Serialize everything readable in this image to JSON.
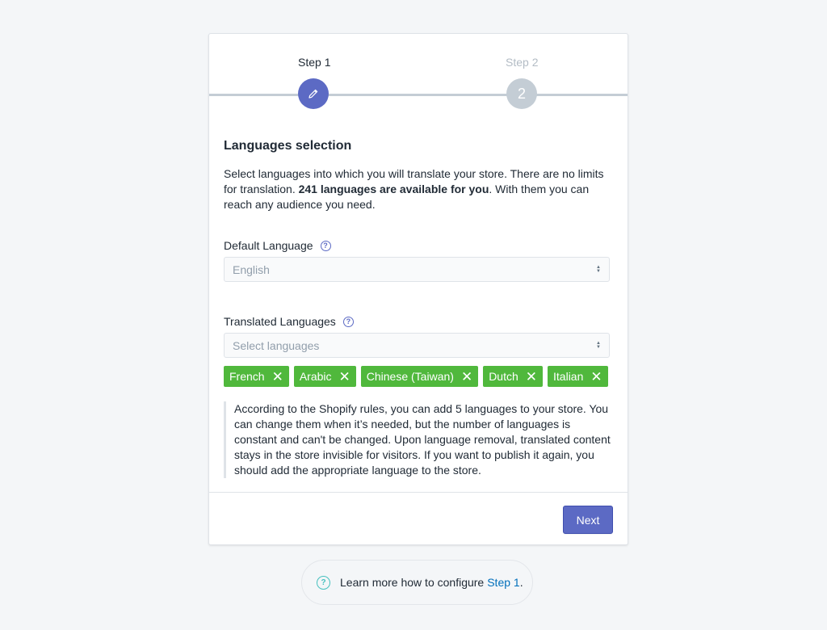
{
  "steps": {
    "step1_label": "Step 1",
    "step2_label": "Step 2",
    "step2_number": "2"
  },
  "section": {
    "title": "Languages selection",
    "desc_part1": "Select languages into which you will translate your store. There are no limits for translation. ",
    "desc_bold": "241 languages are available for you",
    "desc_part2": ". With them you can reach any audience you need."
  },
  "default_language": {
    "label": "Default Language",
    "value": "English"
  },
  "translated_languages": {
    "label": "Translated Languages",
    "placeholder": "Select languages",
    "tags": [
      "French",
      "Arabic",
      "Chinese (Taiwan)",
      "Dutch",
      "Italian"
    ]
  },
  "note": "According to the Shopify rules, you can add 5 languages to your store. You can change them when it’s needed, but the number of languages is constant and can't be changed. Upon language removal, translated content stays in the store invisible for visitors. If you want to publish it again, you should add the appropriate language to the store.",
  "next_label": "Next",
  "learn_more": {
    "text": "Learn more how to configure",
    "link": "Step 1",
    "suffix": "."
  },
  "colors": {
    "accent": "#5c6ac4",
    "tag": "#50b83c",
    "link": "#006fbb"
  }
}
